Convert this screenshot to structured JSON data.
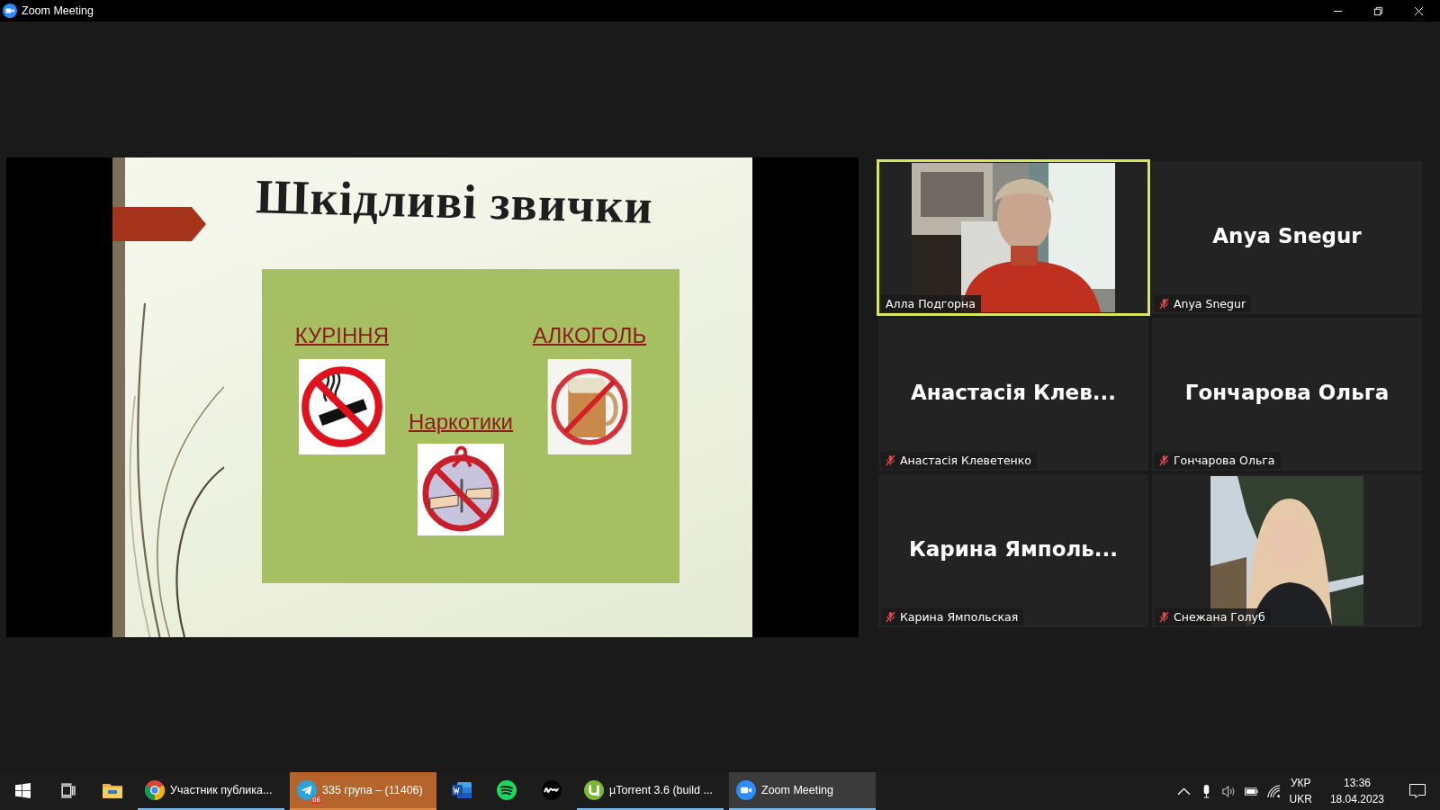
{
  "window": {
    "title": "Zoom Meeting"
  },
  "shared_slide": {
    "title": "Шкідливі звички",
    "items": [
      {
        "kind": "smoking",
        "label": "КУРІННЯ"
      },
      {
        "kind": "drugs",
        "label": "Наркотики"
      },
      {
        "kind": "alcohol",
        "label": "АЛКОГОЛЬ"
      }
    ]
  },
  "participants": [
    {
      "kind": "video",
      "name": "Алла Подгорна",
      "muted": false,
      "speaking": true
    },
    {
      "kind": "avatar",
      "display_name": "Anya Snegur",
      "name": "Anya Snegur",
      "muted": true,
      "speaking": false
    },
    {
      "kind": "avatar",
      "display_name": "Анастасія Клев...",
      "name": "Анастасія Клеветенко",
      "muted": true,
      "speaking": false
    },
    {
      "kind": "avatar",
      "display_name": "Гончарова Ольга",
      "name": "Гончарова Ольга",
      "muted": true,
      "speaking": false
    },
    {
      "kind": "avatar",
      "display_name": "Карина Ямполь...",
      "name": "Карина Ямпольская",
      "muted": true,
      "speaking": false
    },
    {
      "kind": "video2",
      "name": "Снежана Голуб",
      "muted": true,
      "speaking": false
    }
  ],
  "taskbar": {
    "items": [
      {
        "kind": "start",
        "running": false,
        "active": false,
        "flashing": false
      },
      {
        "kind": "taskview",
        "running": false,
        "active": false,
        "flashing": false
      },
      {
        "kind": "folder",
        "running": false,
        "active": false,
        "flashing": false
      },
      {
        "kind": "browser",
        "label": "Участник публика...",
        "running": true,
        "active": false,
        "flashing": false
      },
      {
        "kind": "messenger",
        "label": "335 група – (11406)",
        "badge": "06",
        "running": true,
        "active": false,
        "flashing": true
      },
      {
        "kind": "word",
        "running": false,
        "active": false,
        "flashing": false
      },
      {
        "kind": "music",
        "running": false,
        "active": false,
        "flashing": false
      },
      {
        "kind": "rave",
        "running": false,
        "active": false,
        "flashing": false
      },
      {
        "kind": "torrent",
        "label": "µTorrent 3.6  (build ...",
        "running": true,
        "active": false,
        "flashing": false
      },
      {
        "kind": "zoom",
        "label": "Zoom Meeting",
        "running": true,
        "active": true,
        "flashing": false
      }
    ],
    "language": [
      "УКР",
      "UKR"
    ],
    "time": "13:36",
    "date": "18.04.2023"
  }
}
